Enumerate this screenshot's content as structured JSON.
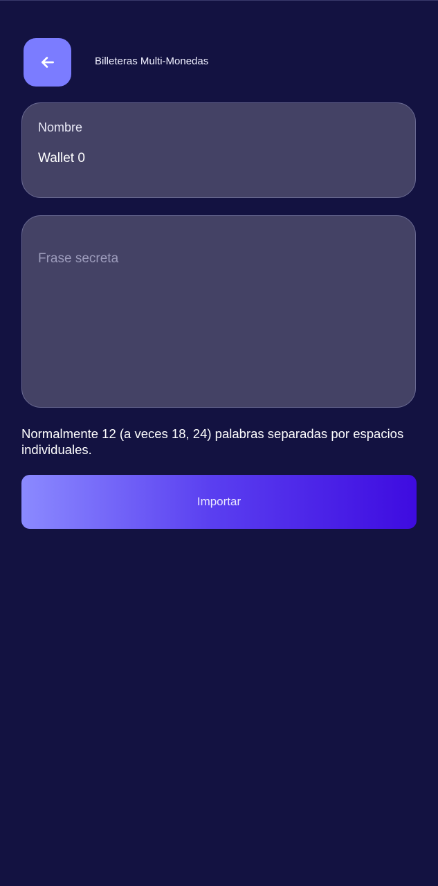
{
  "header": {
    "back_icon": "arrow-left-icon",
    "title": "Billeteras Multi-Monedas"
  },
  "name_field": {
    "label": "Nombre",
    "value": "Wallet 0"
  },
  "phrase_field": {
    "placeholder": "Frase secreta",
    "value": ""
  },
  "hint": "Normalmente 12 (a veces 18, 24) palabras separadas por espacios individuales.",
  "import_button": {
    "label": "Importar"
  },
  "colors": {
    "background": "#131241",
    "accent": "#7b7cff",
    "card": "#444265",
    "button_gradient_start": "#8b8aff",
    "button_gradient_end": "#3e0be0"
  }
}
